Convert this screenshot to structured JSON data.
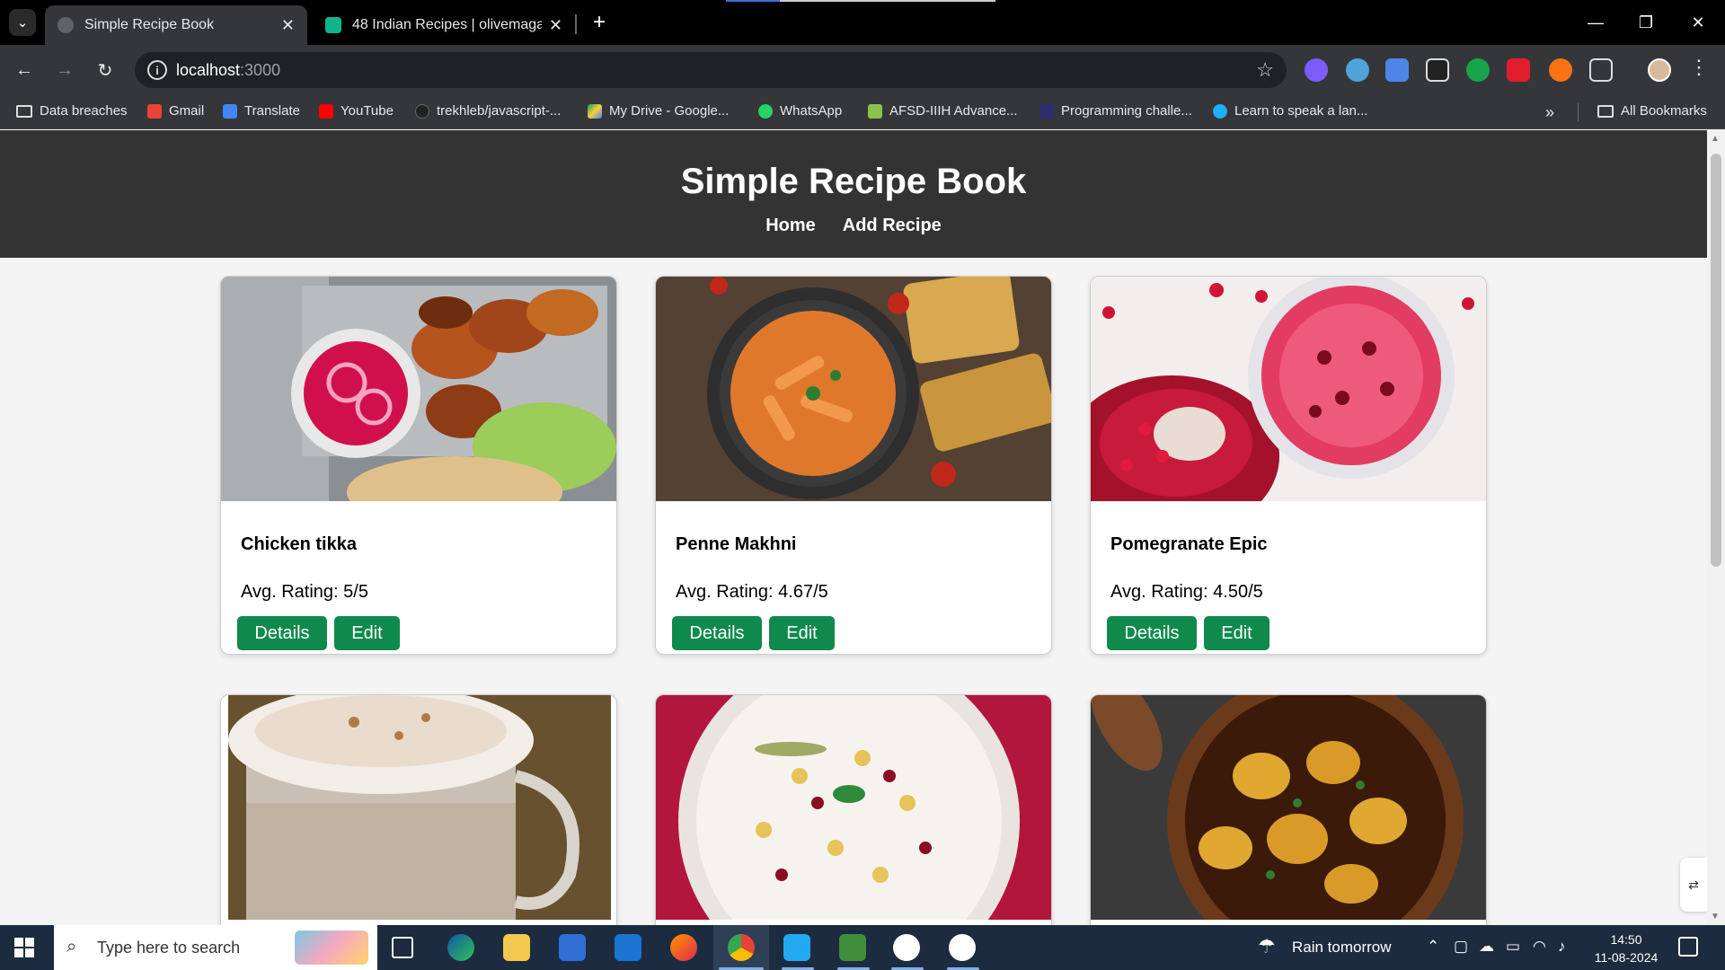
{
  "browser": {
    "tabs": [
      {
        "title": "Simple Recipe Book",
        "active": true
      },
      {
        "title": "48 Indian Recipes | olivemagazi",
        "active": false
      }
    ],
    "url_host": "localhost",
    "url_port": ":3000",
    "bookmarks": [
      {
        "label": "Data breaches",
        "icon": "folder-icon"
      },
      {
        "label": "Gmail",
        "icon": "gmail-icon"
      },
      {
        "label": "Translate",
        "icon": "translate-icon"
      },
      {
        "label": "YouTube",
        "icon": "youtube-icon"
      },
      {
        "label": "trekhleb/javascript-...",
        "icon": "github-icon"
      },
      {
        "label": "My Drive - Google...",
        "icon": "drive-icon"
      },
      {
        "label": "WhatsApp",
        "icon": "whatsapp-icon"
      },
      {
        "label": "AFSD-IIIH Advance...",
        "icon": "afsd-icon"
      },
      {
        "label": "Programming challe...",
        "icon": "challenge-icon"
      },
      {
        "label": "Learn to speak a lan...",
        "icon": "duolingo-icon"
      }
    ],
    "all_bookmarks": "All Bookmarks",
    "overflow": "»"
  },
  "site": {
    "title": "Simple Recipe Book",
    "nav": {
      "home": "Home",
      "add": "Add Recipe"
    }
  },
  "recipes": [
    {
      "name": "Chicken tikka",
      "rating": "Avg. Rating: 5/5",
      "details": "Details",
      "edit": "Edit"
    },
    {
      "name": "Penne Makhni",
      "rating": "Avg. Rating: 4.67/5",
      "details": "Details",
      "edit": "Edit"
    },
    {
      "name": "Pomegranate Epic",
      "rating": "Avg. Rating: 4.50/5",
      "details": "Details",
      "edit": "Edit"
    },
    {
      "name": "",
      "rating": "",
      "details": "",
      "edit": ""
    },
    {
      "name": "",
      "rating": "",
      "details": "",
      "edit": ""
    },
    {
      "name": "",
      "rating": "",
      "details": "",
      "edit": ""
    }
  ],
  "taskbar": {
    "search_placeholder": "Type here to search",
    "weather": "Rain tomorrow",
    "time": "14:50",
    "date": "11-08-2024"
  },
  "colors": {
    "header_bg": "#333333",
    "button_green": "#0f8a4c",
    "page_bg": "#f4f4f4"
  }
}
